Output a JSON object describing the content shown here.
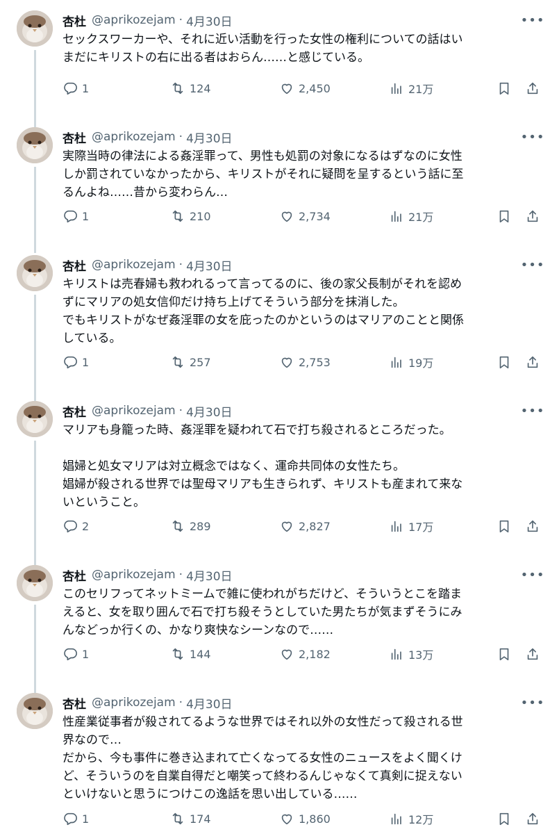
{
  "tweets": [
    {
      "name": "杏杜",
      "handle": "@aprikozejam",
      "dot": "·",
      "date": "4月30日",
      "paragraphs": [
        "セックスワーカーや、それに近い活動を行った女性の権利についての話はい\nまだにキリストの右に出る者はおらん……と感じている。"
      ],
      "replies": "1",
      "retweets": "124",
      "likes": "2,450",
      "views": "21万"
    },
    {
      "name": "杏杜",
      "handle": "@aprikozejam",
      "dot": "·",
      "date": "4月30日",
      "paragraphs": [
        "実際当時の律法による姦淫罪って、男性も処罰の対象になるはずなのに女性\nしか罰されていなかったから、キリストがそれに疑問を呈するという話に至\nるんよね……昔から変わらん…"
      ],
      "replies": "1",
      "retweets": "210",
      "likes": "2,734",
      "views": "21万"
    },
    {
      "name": "杏杜",
      "handle": "@aprikozejam",
      "dot": "·",
      "date": "4月30日",
      "paragraphs": [
        "キリストは売春婦も救われるって言ってるのに、後の家父長制がそれを認め\nずにマリアの処女信仰だけ持ち上げてそういう部分を抹消した。\nでもキリストがなぜ姦淫罪の女を庇ったのかというのはマリアのことと関係\nしている。"
      ],
      "replies": "1",
      "retweets": "257",
      "likes": "2,753",
      "views": "19万"
    },
    {
      "name": "杏杜",
      "handle": "@aprikozejam",
      "dot": "·",
      "date": "4月30日",
      "paragraphs": [
        "マリアも身籠った時、姦淫罪を疑われて石で打ち殺されるところだった。\n\n娼婦と処女マリアは対立概念ではなく、運命共同体の女性たち。\n娼婦が殺される世界では聖母マリアも生きられず、キリストも産まれて来な\nいということ。"
      ],
      "replies": "2",
      "retweets": "289",
      "likes": "2,827",
      "views": "17万"
    },
    {
      "name": "杏杜",
      "handle": "@aprikozejam",
      "dot": "·",
      "date": "4月30日",
      "paragraphs": [
        "このセリフってネットミームで雑に使われがちだけど、そういうとこを踏ま\nえると、女を取り囲んで石で打ち殺そうとしていた男たちが気まずそうにみ\nんなどっか行くの、かなり爽快なシーンなので……"
      ],
      "replies": "1",
      "retweets": "144",
      "likes": "2,182",
      "views": "13万"
    },
    {
      "name": "杏杜",
      "handle": "@aprikozejam",
      "dot": "·",
      "date": "4月30日",
      "paragraphs": [
        "性産業従事者が殺されてるような世界ではそれ以外の女性だって殺される世\n界なので…\nだから、今も事件に巻き込まれて亡くなってる女性のニュースをよく聞くけ\nど、そういうのを自業自得だと嘲笑って終わるんじゃなくて真剣に捉えない\nといけないと思うにつけこの逸話を思い出している……"
      ],
      "replies": "1",
      "retweets": "174",
      "likes": "1,860",
      "views": "12万"
    }
  ],
  "icons": {
    "more": "more-icon",
    "reply": "reply-icon",
    "retweet": "retweet-icon",
    "like": "heart-icon",
    "views": "views-icon",
    "bookmark": "bookmark-icon",
    "share": "share-icon"
  },
  "colors": {
    "text": "#0f1419",
    "secondary": "#536471",
    "thread_line": "#cfd9de"
  }
}
